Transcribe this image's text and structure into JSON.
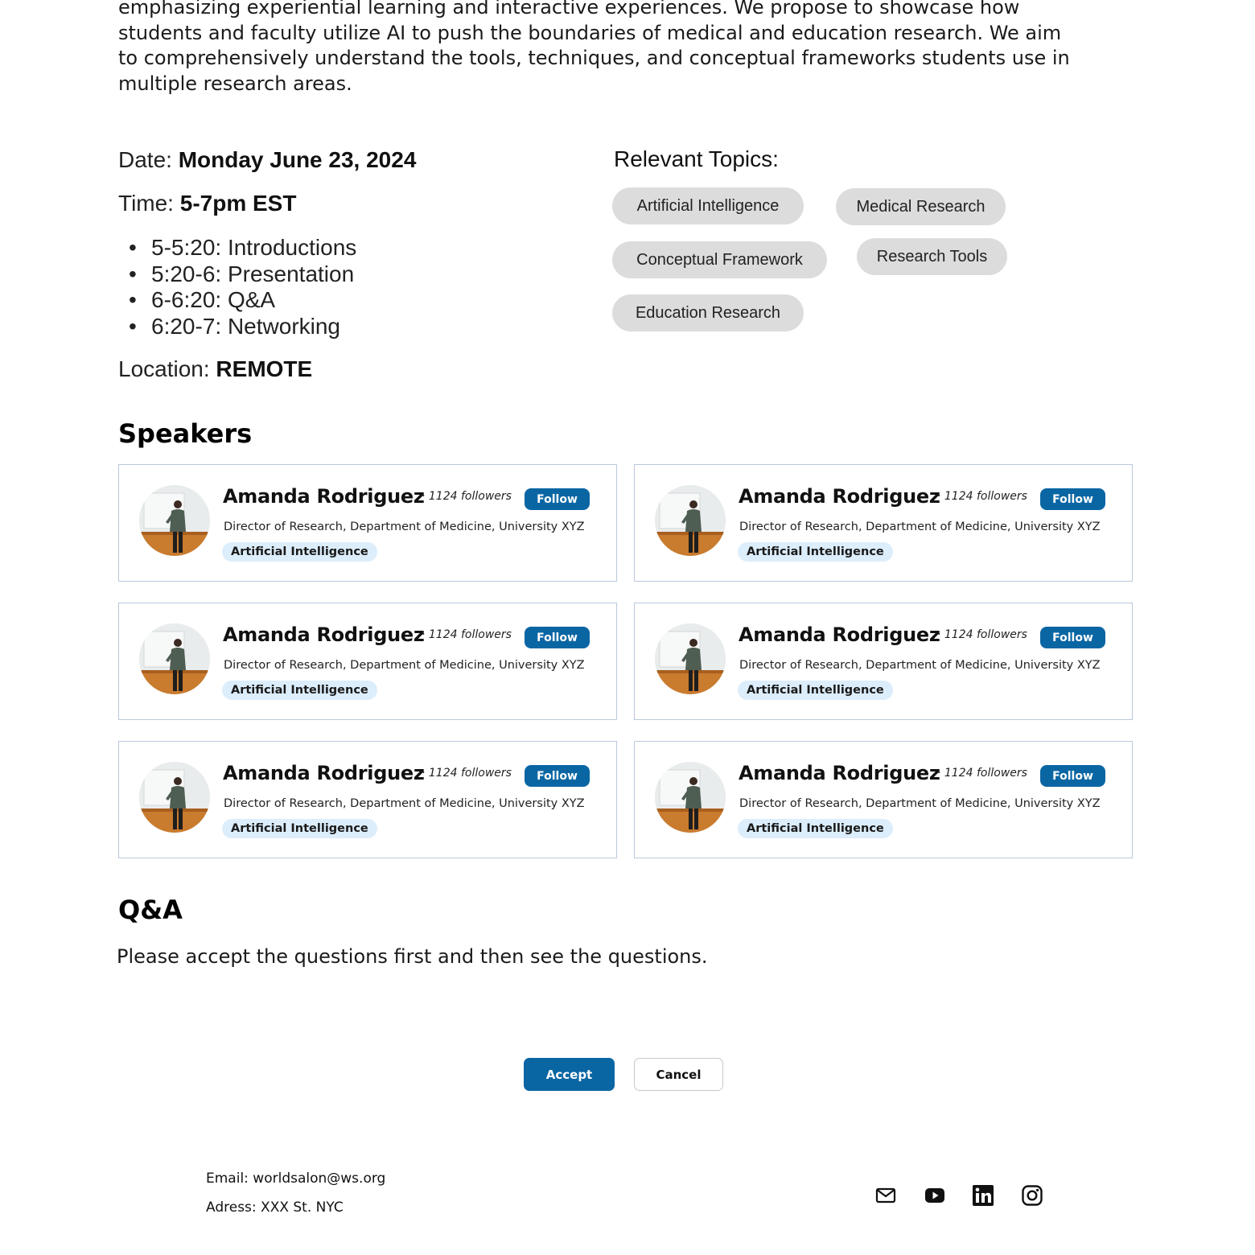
{
  "intro": {
    "lines": [
      "emphasizing experiential learning and interactive experiences. We propose to showcase how",
      "students and faculty utilize AI to push the boundaries of medical and education research. We aim",
      "to comprehensively understand the tools, techniques, and conceptual frameworks students use in",
      "multiple research areas."
    ]
  },
  "event": {
    "date_label": "Date:",
    "date_value": "Monday June 23, 2024",
    "time_label": "Time:",
    "time_value": "5-7pm EST",
    "schedule": [
      "5-5:20: Introductions",
      "5:20-6: Presentation",
      "6-6:20: Q&A",
      "6:20-7: Networking"
    ],
    "location_label": "Location:",
    "location_value": "REMOTE"
  },
  "topics": {
    "title": "Relevant Topics:",
    "items": [
      "Artificial Intelligence",
      "Medical Research",
      "Conceptual Framework",
      "Research Tools",
      "Education Research"
    ]
  },
  "speakers": {
    "title": "Speakers",
    "items": [
      {
        "name": "Amanda Rodriguez",
        "followers": "· 1124 followers",
        "follow_label": "Follow",
        "title": "Director of Research, Department of Medicine, University XYZ",
        "tag": "Artificial Intelligence"
      },
      {
        "name": "Amanda Rodriguez",
        "followers": "· 1124 followers",
        "follow_label": "Follow",
        "title": "Director of Research, Department of Medicine, University XYZ",
        "tag": "Artificial Intelligence"
      },
      {
        "name": "Amanda Rodriguez",
        "followers": "· 1124 followers",
        "follow_label": "Follow",
        "title": "Director of Research, Department of Medicine, University XYZ",
        "tag": "Artificial Intelligence"
      },
      {
        "name": "Amanda Rodriguez",
        "followers": "· 1124 followers",
        "follow_label": "Follow",
        "title": "Director of Research, Department of Medicine, University XYZ",
        "tag": "Artificial Intelligence"
      },
      {
        "name": "Amanda Rodriguez",
        "followers": "· 1124 followers",
        "follow_label": "Follow",
        "title": "Director of Research, Department of Medicine, University XYZ",
        "tag": "Artificial Intelligence"
      },
      {
        "name": "Amanda Rodriguez",
        "followers": "· 1124 followers",
        "follow_label": "Follow",
        "title": "Director of Research, Department of Medicine, University XYZ",
        "tag": "Artificial Intelligence"
      }
    ]
  },
  "qa": {
    "title": "Q&A",
    "text": "Please accept the questions first and then see the questions.",
    "accept_label": "Accept",
    "cancel_label": "Cancel"
  },
  "footer": {
    "email": "Email: worldsalon@ws.org",
    "address": "Adress: XXX St. NYC",
    "icons": [
      "mail-icon",
      "youtube-icon",
      "linkedin-icon",
      "instagram-icon"
    ]
  },
  "colors": {
    "primary_blue": "#0a66a3",
    "pill_gray": "#dcdcdc",
    "tag_blue": "#dcedfb",
    "card_border": "#b9c9dc"
  }
}
